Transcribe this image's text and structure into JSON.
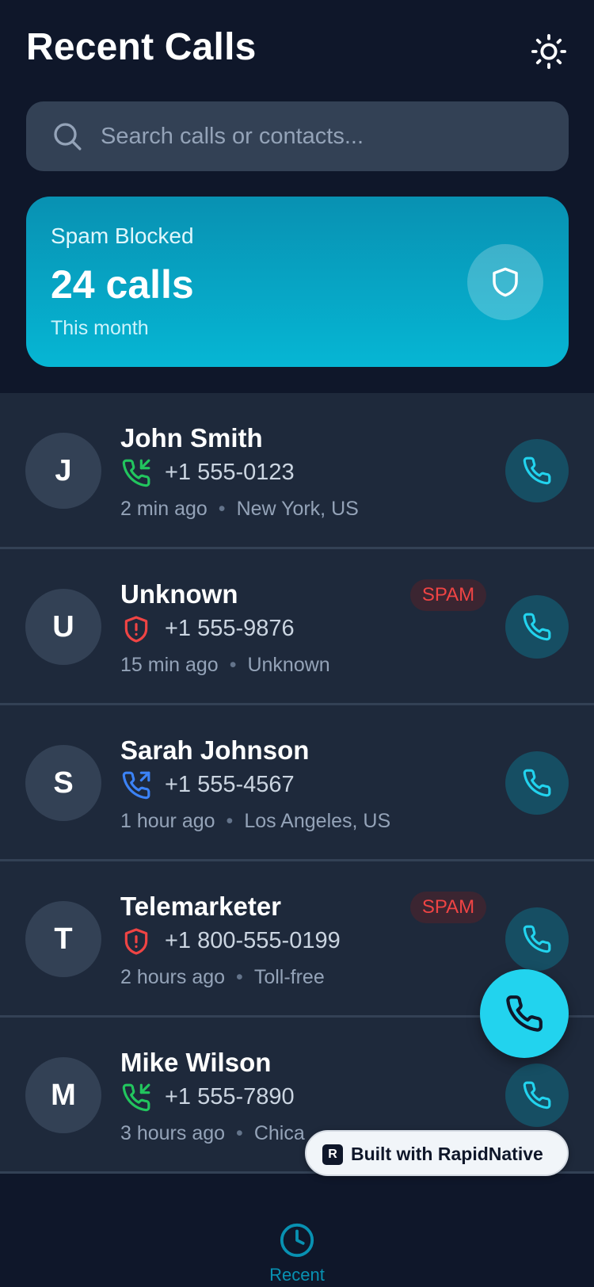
{
  "header": {
    "title": "Recent Calls",
    "theme_icon": "sun-icon"
  },
  "search": {
    "placeholder": "Search calls or contacts..."
  },
  "spam_summary": {
    "label": "Spam Blocked",
    "count": "24 calls",
    "period": "This month",
    "icon": "shield-icon"
  },
  "calls": [
    {
      "initial": "J",
      "name": "John Smith",
      "number": "+1 555-0123",
      "time": "2 min ago",
      "location": "New York, US",
      "direction": "incoming",
      "spam": false
    },
    {
      "initial": "U",
      "name": "Unknown",
      "number": "+1 555-9876",
      "time": "15 min ago",
      "location": "Unknown",
      "direction": "spam",
      "spam": true,
      "badge": "SPAM"
    },
    {
      "initial": "S",
      "name": "Sarah Johnson",
      "number": "+1 555-4567",
      "time": "1 hour ago",
      "location": "Los Angeles, US",
      "direction": "outgoing",
      "spam": false
    },
    {
      "initial": "T",
      "name": "Telemarketer",
      "number": "+1 800-555-0199",
      "time": "2 hours ago",
      "location": "Toll-free",
      "direction": "spam",
      "spam": true,
      "badge": "SPAM"
    },
    {
      "initial": "M",
      "name": "Mike Wilson",
      "number": "+1 555-7890",
      "time": "3 hours ago",
      "location": "Chica",
      "direction": "incoming",
      "spam": false
    }
  ],
  "built_with": {
    "text": "Built with RapidNative",
    "logo": "R"
  },
  "bottom_nav": {
    "items": [
      {
        "label": "Recent",
        "icon": "clock-icon",
        "active": true
      }
    ]
  },
  "colors": {
    "background": "#0f172a",
    "row": "#1e293b",
    "accent": "#22d3ee",
    "incoming": "#22c55e",
    "outgoing": "#3b82f6",
    "spam": "#ef4444"
  }
}
